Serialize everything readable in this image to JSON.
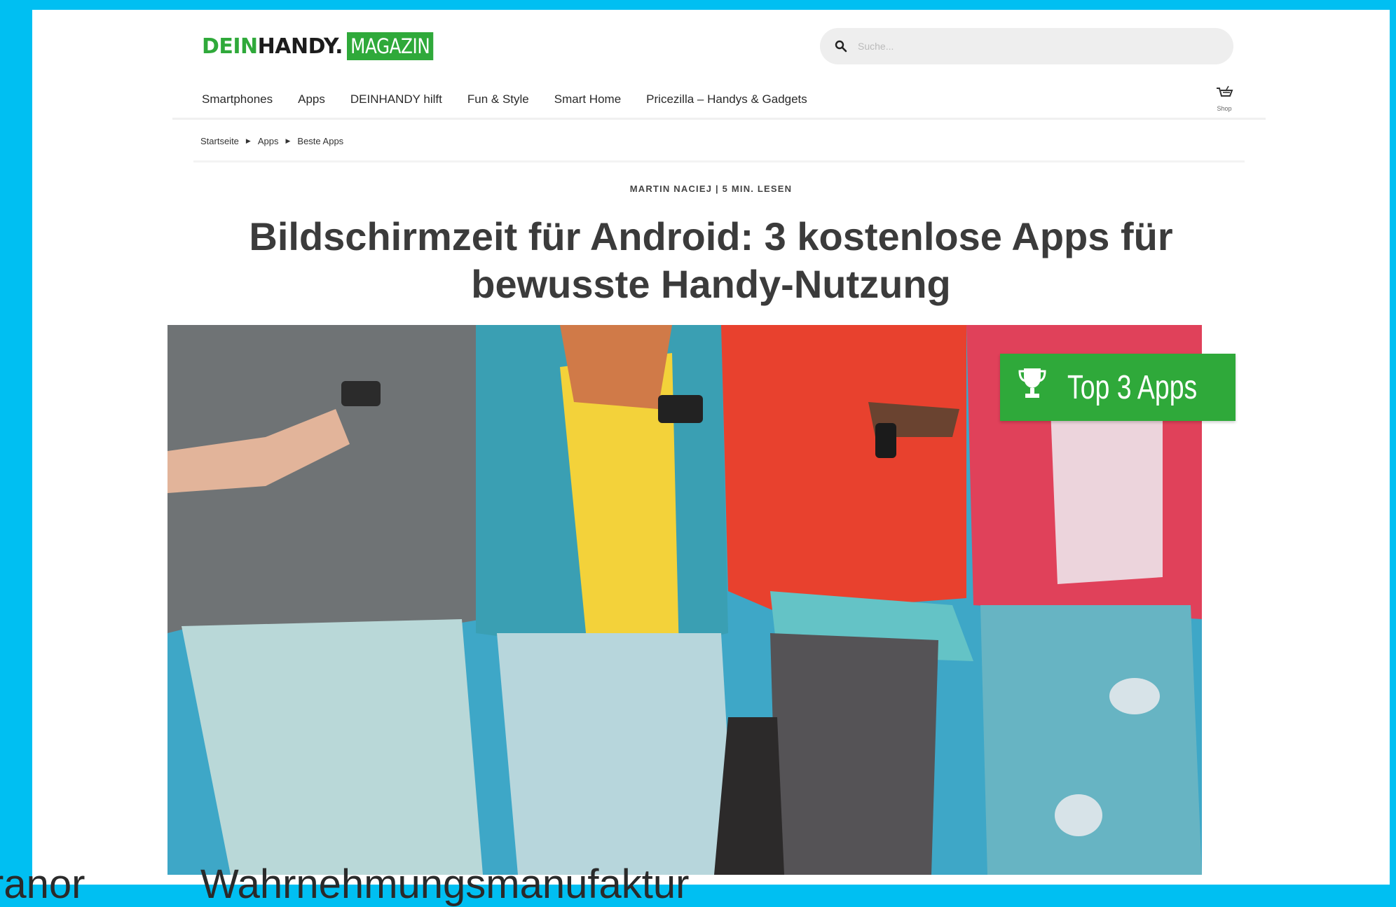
{
  "logo": {
    "part1": "DEIN",
    "part2": "HANDY.",
    "tag": "MAGAZIN"
  },
  "search": {
    "placeholder": "Suche..."
  },
  "nav": {
    "items": [
      "Smartphones",
      "Apps",
      "DEINHANDY hilft",
      "Fun & Style",
      "Smart Home",
      "Pricezilla – Handys & Gadgets"
    ],
    "shop_label": "Shop"
  },
  "breadcrumb": {
    "items": [
      "Startseite",
      "Apps",
      "Beste Apps"
    ]
  },
  "article": {
    "byline": "MARTIN NACIEJ | 5 MIN. LESEN",
    "title": "Bildschirmzeit für Android: 3 kostenlose Apps für bewusste Handy-Nutzung"
  },
  "hero": {
    "badge_text": "Top 3 Apps"
  },
  "overlay": {
    "word1": "ranor",
    "word2": "Wahrnehmungsmanufaktur"
  },
  "colors": {
    "frame": "#00bff2",
    "brand_green": "#2fa93a",
    "hero_bg": "#3ea7c7"
  }
}
